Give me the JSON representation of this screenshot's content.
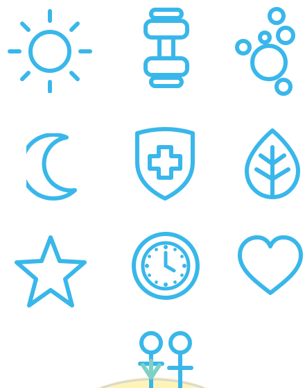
{
  "icon_color": "#39b7ea",
  "watermark_colors": {
    "arrow": "#7ed1c5",
    "yellow": "#fff4b8",
    "gray": "#d8d8d8"
  },
  "icons": [
    {
      "name": "sun-icon"
    },
    {
      "name": "dumbbell-icon"
    },
    {
      "name": "bubbles-icon"
    },
    {
      "name": "crescent-moon-icon"
    },
    {
      "name": "medical-shield-icon"
    },
    {
      "name": "leaf-icon"
    },
    {
      "name": "star-icon"
    },
    {
      "name": "clock-icon"
    },
    {
      "name": "heart-icon"
    },
    {
      "name": "gender-symbols-icon"
    }
  ]
}
